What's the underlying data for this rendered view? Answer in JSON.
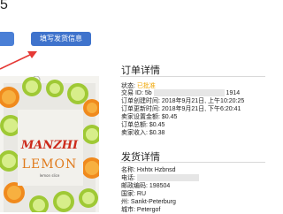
{
  "header": {
    "title": "5",
    "fill_shipping_button": "填写发货信息"
  },
  "product": {
    "brand": "MANZHI",
    "name": "LEMON",
    "subtitle": "lemon slice",
    "image_colors": {
      "bag": "#e9e8e3",
      "lemon": "#9fc935",
      "orange": "#f08a1d",
      "brand_text": "#cc2a1b"
    }
  },
  "order": {
    "section_title": "订单详情",
    "status_label": "状态:",
    "status_value": "已批准",
    "txn_label": "交易 ID:",
    "txn_prefix": "5b",
    "txn_suffix": "1914",
    "created_label": "订单创建时间:",
    "created_value": "2018年9月21日, 上午10:20:25",
    "updated_label": "订单更新时间:",
    "updated_value": "2018年9月21日, 下午6:20:41",
    "seller_fee_label": "卖家设置金额:",
    "seller_fee_value": "$0.45",
    "total_label": "订单总额:",
    "total_value": "$0.45",
    "seller_income_label": "卖家收入:",
    "seller_income_value": "$0.38"
  },
  "shipping": {
    "section_title": "发货详情",
    "name_label": "名称:",
    "name_value": "Hxhtx Hzbnsd",
    "phone_label": "电话:",
    "zip_label": "邮政编码:",
    "zip_value": "198504",
    "country_label": "国家:",
    "country_value": "RU",
    "state_label": "州:",
    "state_value": "Sankt-Peterburg",
    "city_label": "城市:",
    "city_value": "Petergof"
  },
  "colors": {
    "primary_button": "#3f73cc",
    "status_text": "#f0a500",
    "arrow": "#e53935"
  }
}
